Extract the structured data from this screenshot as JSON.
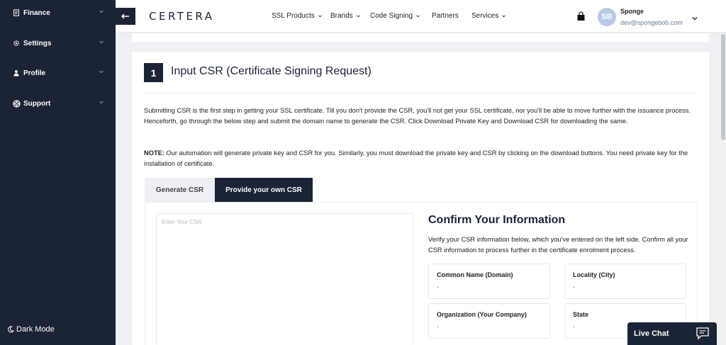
{
  "sidebar": {
    "items": [
      {
        "label": "Finance",
        "icon": "document-icon"
      },
      {
        "label": "Settings",
        "icon": "gear-icon"
      },
      {
        "label": "Profile",
        "icon": "person-icon"
      },
      {
        "label": "Support",
        "icon": "lifebuoy-icon"
      }
    ],
    "dark_mode_label": "Dark Mode"
  },
  "header": {
    "logo_text": "CERTERA",
    "nav": [
      {
        "label": "SSL Products",
        "has_dropdown": true
      },
      {
        "label": "Brands",
        "has_dropdown": true
      },
      {
        "label": "Code Signing",
        "has_dropdown": true
      },
      {
        "label": "Partners",
        "has_dropdown": false
      },
      {
        "label": "Services",
        "has_dropdown": true
      }
    ],
    "user": {
      "initials": "SB",
      "name": "Sponge",
      "email": "dev@spongebob.com"
    }
  },
  "step": {
    "number": "1",
    "title": "Input CSR (Certificate Signing Request)",
    "intro": "Submitting CSR is the first step in getting your SSL certificate. Till you don't provide the CSR, you'll not get your SSL certificate, nor you'll be able to move further with the issuance process. Henceforth, go through the below step and submit the domain name to generate the CSR. Click Download Private Key and Download CSR for downloading the same.",
    "note_label": "NOTE:",
    "note_text": " Our automation will generate private key and CSR for you. Similarly, you must download the private key and CSR by clicking on the download buttons. You need private key for the installation of certificate."
  },
  "tabs": [
    {
      "label": "Generate CSR",
      "active": false
    },
    {
      "label": "Provide your own CSR",
      "active": true
    }
  ],
  "csr_input": {
    "placeholder": "Enter Your CSR",
    "value": ""
  },
  "confirm": {
    "title": "Confirm Your Information",
    "description": "Verify your CSR information below, which you've entered on the left side. Confirm all your CSR information to process further in the certificate enrolment process.",
    "fields": [
      {
        "label": "Common Name (Domain)",
        "value": "-"
      },
      {
        "label": "Locality (City)",
        "value": "-"
      },
      {
        "label": "Organization (Your Company)",
        "value": "-"
      },
      {
        "label": "State",
        "value": "-"
      }
    ]
  },
  "live_chat": {
    "label": "Live Chat"
  },
  "colors": {
    "navy": "#1b2336",
    "page_bg": "#eef0f3",
    "avatar_bg": "#b9c8e6"
  }
}
